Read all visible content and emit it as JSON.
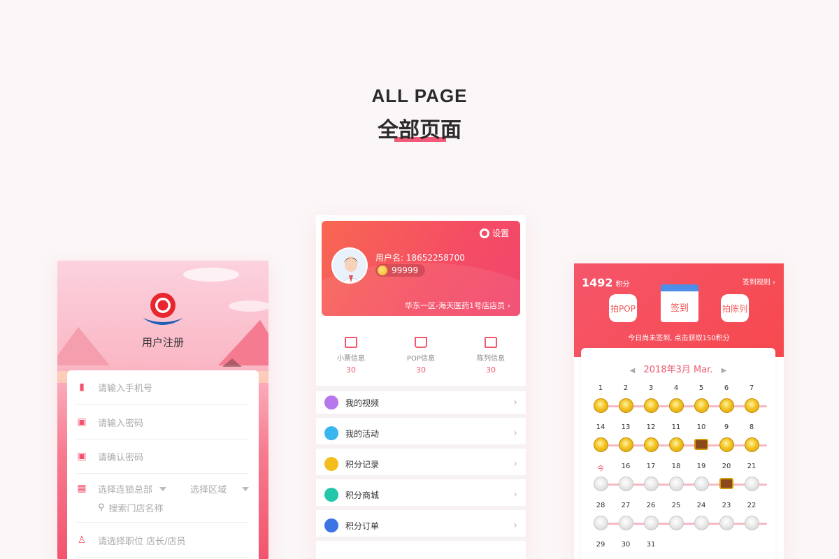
{
  "heading": {
    "en": "ALL PAGE",
    "zh": "全部页面"
  },
  "register": {
    "title": "用户注册",
    "fields": {
      "phone": "请输入手机号",
      "password": "请输入密码",
      "confirm": "请确认密码",
      "chain": "选择连锁总部",
      "region": "选择区域",
      "store_search": "搜索门店名称",
      "position": "请选择职位 店长/店员"
    }
  },
  "profile": {
    "settings": "设置",
    "username": "用户名: 18652258700",
    "points": "99999",
    "store": "华东一区-海天医药1号店店员",
    "stats": [
      {
        "label": "小票信息",
        "value": "30"
      },
      {
        "label": "POP信息",
        "value": "30"
      },
      {
        "label": "陈列信息",
        "value": "30"
      }
    ],
    "menu": [
      {
        "label": "我的视频",
        "color": "#b777ec"
      },
      {
        "label": "我的活动",
        "color": "#3ab6ee"
      },
      {
        "label": "积分记录",
        "color": "#f4bd1b"
      },
      {
        "label": "积分商城",
        "color": "#22c7a9"
      },
      {
        "label": "积分订单",
        "color": "#3c74e6"
      }
    ]
  },
  "checkin": {
    "score": "1492",
    "score_unit": "积分",
    "rules": "签到规则",
    "btn_pop": "拍POP",
    "btn_sign": "签到",
    "btn_display": "拍陈列",
    "tip": "今日尚未签到, 点击获取150积分",
    "month": "2018年3月 Mar.",
    "weeks": [
      {
        "days": [
          "1",
          "2",
          "3",
          "4",
          "5",
          "6",
          "7"
        ],
        "marks": [
          "gold",
          "gold",
          "gold",
          "gold",
          "gold",
          "gold",
          "gold"
        ]
      },
      {
        "days": [
          "14",
          "13",
          "12",
          "11",
          "10",
          "9",
          "8"
        ],
        "marks": [
          "gold",
          "gold",
          "gold",
          "gold",
          "chest",
          "gold",
          "gold"
        ]
      },
      {
        "days": [
          "今",
          "16",
          "17",
          "18",
          "19",
          "20",
          "21"
        ],
        "marks": [
          "grey",
          "grey",
          "grey",
          "grey",
          "grey",
          "chest",
          "grey"
        ]
      },
      {
        "days": [
          "28",
          "27",
          "26",
          "25",
          "24",
          "23",
          "22"
        ],
        "marks": [
          "grey",
          "grey",
          "grey",
          "grey",
          "grey",
          "grey",
          "grey"
        ]
      },
      {
        "days": [
          "29",
          "30",
          "31",
          "",
          "",
          "",
          ""
        ],
        "marks": [
          "",
          "",
          "",
          "",
          "",
          "",
          ""
        ]
      }
    ]
  }
}
